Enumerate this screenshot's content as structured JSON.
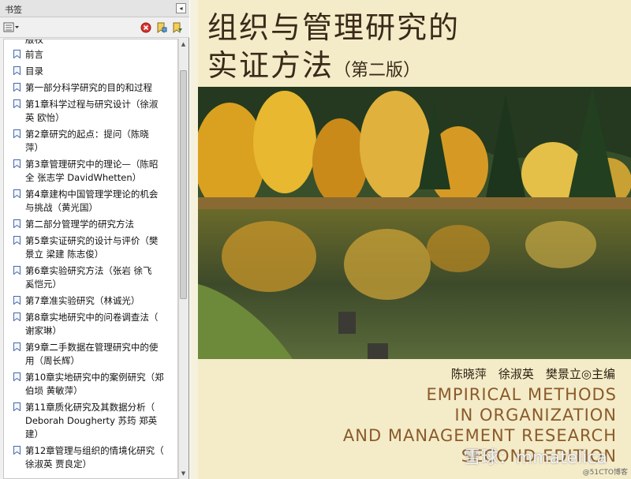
{
  "panel": {
    "title": "书签",
    "collapse_icon": "◂"
  },
  "toolbar": {
    "options_icon": "options-icon",
    "delete_icon": "delete-icon",
    "new_bookmark_icon": "new-bookmark-icon",
    "expand_icon": "expand-bookmark-icon"
  },
  "bookmarks": {
    "cut_label": "版权",
    "items": [
      {
        "lines": [
          "前言"
        ]
      },
      {
        "lines": [
          "目录"
        ]
      },
      {
        "lines": [
          "第一部分科学研究的目的和过程"
        ]
      },
      {
        "lines": [
          "第1章科学过程与研究设计（徐淑",
          "英 欧怡）"
        ]
      },
      {
        "lines": [
          "第2章研究的起点：提问（陈晓",
          "萍）"
        ]
      },
      {
        "lines": [
          "第3章管理研究中的理论—（陈昭",
          "全 张志学 DavidWhetten）"
        ]
      },
      {
        "lines": [
          "第4章建构中国管理学理论的机会",
          "与挑战（黄光国）"
        ]
      },
      {
        "lines": [
          "第二部分管理学的研究方法"
        ]
      },
      {
        "lines": [
          "第5章实证研究的设计与评价（樊",
          "景立 梁建 陈志俊）"
        ]
      },
      {
        "lines": [
          "第6章实验研究方法（张岩 徐飞",
          "奚恺元）"
        ]
      },
      {
        "lines": [
          "第7章准实验研究（林诚光）"
        ]
      },
      {
        "lines": [
          "第8章实地研究中的问卷调查法（",
          "谢家琳）"
        ]
      },
      {
        "lines": [
          "第9章二手数据在管理研究中的使",
          "用（周长辉）"
        ]
      },
      {
        "lines": [
          "第10章实地研究中的案例研究（郑",
          "伯埙 黄敏萍）"
        ]
      },
      {
        "lines": [
          "第11章质化研究及其数据分析（",
          "Deborah Dougherty 苏筠 郑英",
          "建）"
        ]
      },
      {
        "lines": [
          "第12章管理与组织的情境化研究（",
          "徐淑英 贾良定）"
        ]
      }
    ]
  },
  "cover": {
    "title_line1": "组织与管理研究的",
    "title_line2": "实证方法",
    "edition": "（第二版）",
    "authors": "陈晓萍　徐淑英　樊景立◎主编",
    "english_line1": "EMPIRICAL METHODS",
    "english_line2": "IN ORGANIZATION",
    "english_line3": "AND MANAGEMENT RESEARCH",
    "english_line4": "SECOND EDITION"
  },
  "watermark": {
    "text": "雪球：mmatelica",
    "credit": "@51CTO博客"
  },
  "colors": {
    "accent_red": "#cc2222",
    "folder_yellow": "#e8b43c",
    "title_brown": "#3a2a1a",
    "english_brown": "#8b5a2b"
  }
}
